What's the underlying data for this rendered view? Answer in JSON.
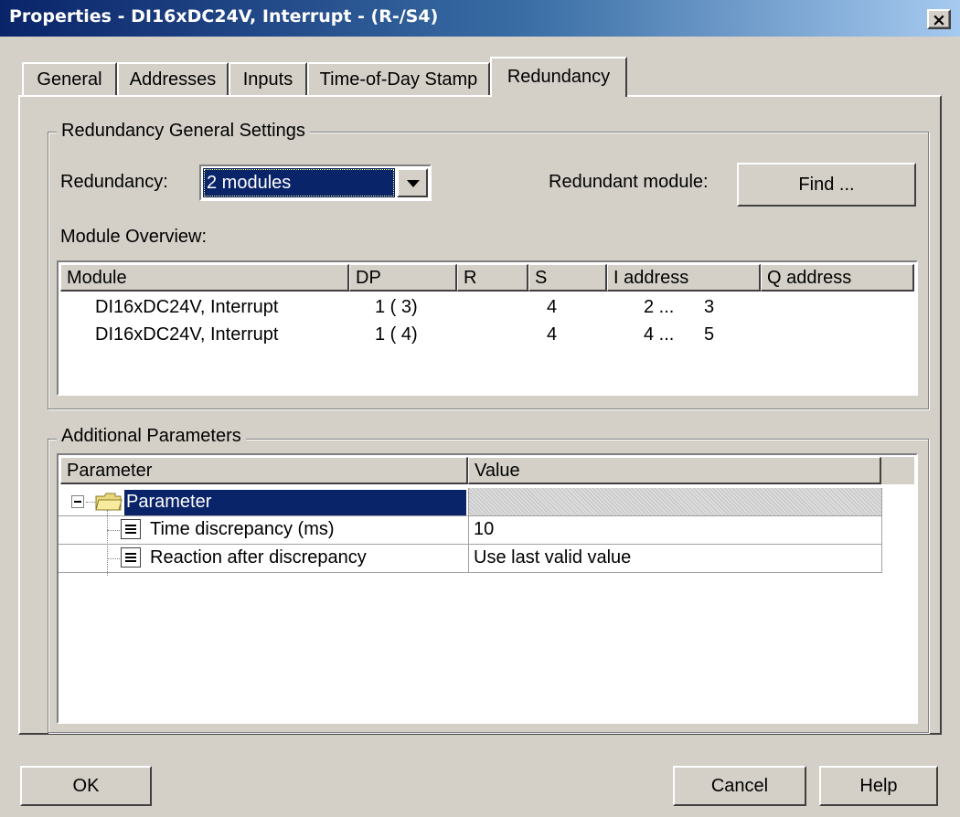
{
  "window": {
    "title": "Properties - DI16xDC24V, Interrupt - (R-/S4)",
    "close": "×"
  },
  "tabs": [
    {
      "label": "General"
    },
    {
      "label": "Addresses"
    },
    {
      "label": "Inputs"
    },
    {
      "label": "Time-of-Day Stamp"
    },
    {
      "label": "Redundancy"
    }
  ],
  "redundancy_group": {
    "title": "Redundancy General Settings",
    "redundancy_label": "Redundancy:",
    "redundancy_value": "2 modules",
    "redundant_module_label": "Redundant module:",
    "find_button": "Find ...",
    "overview_label": "Module Overview:",
    "columns": [
      "Module",
      "DP",
      "R",
      "S",
      "I address",
      "Q address"
    ],
    "rows": [
      {
        "module": "DI16xDC24V, Interrupt",
        "dp": "1 ( 3)",
        "r": "",
        "s": "4",
        "i_start": "2 ...",
        "i_end": "3",
        "q": ""
      },
      {
        "module": "DI16xDC24V, Interrupt",
        "dp": "1 ( 4)",
        "r": "",
        "s": "4",
        "i_start": "4 ...",
        "i_end": "5",
        "q": ""
      }
    ]
  },
  "additional_group": {
    "title": "Additional Parameters",
    "columns": [
      "Parameter",
      "Value"
    ],
    "root": {
      "label": "Parameter",
      "expander": "−"
    },
    "params": [
      {
        "name": "Time discrepancy (ms)",
        "value": "10"
      },
      {
        "name": "Reaction after discrepancy",
        "value": "Use last valid value"
      }
    ]
  },
  "buttons": {
    "ok": "OK",
    "cancel": "Cancel",
    "help": "Help"
  },
  "colors": {
    "selection": "#0a246a",
    "face": "#d4d0c8",
    "title_start": "#0a246a",
    "title_end": "#a6caf0"
  }
}
